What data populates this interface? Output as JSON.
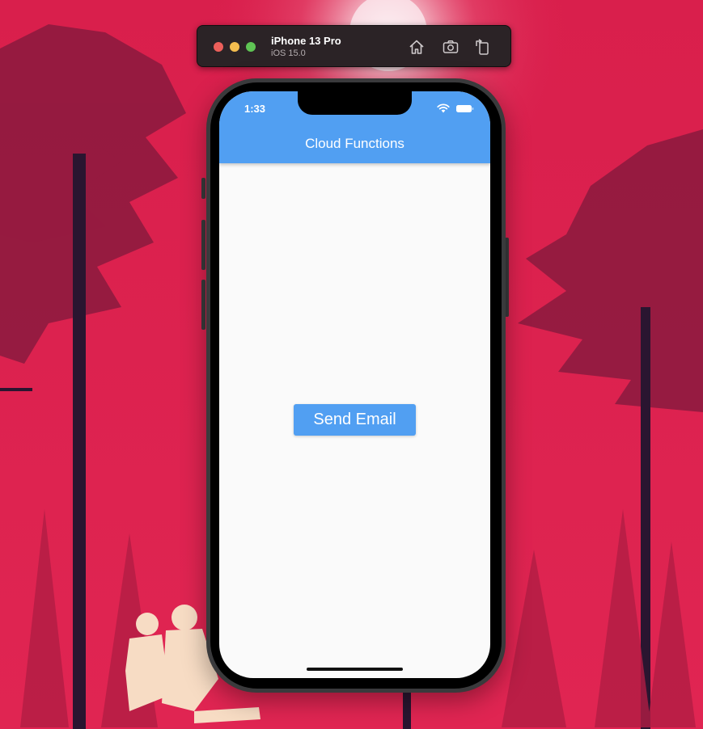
{
  "simulator": {
    "device_name": "iPhone 13 Pro",
    "os_version": "iOS 15.0",
    "toolbar_icons": [
      "home-icon",
      "screenshot-icon",
      "rotate-icon"
    ]
  },
  "status_bar": {
    "time": "1:33",
    "icons": [
      "wifi-icon",
      "battery-icon"
    ]
  },
  "app": {
    "title": "Cloud Functions",
    "button_label": "Send Email"
  },
  "colors": {
    "app_accent": "#519ff2",
    "wallpaper_red": "#dc2350",
    "screen_background": "#fafafa"
  }
}
